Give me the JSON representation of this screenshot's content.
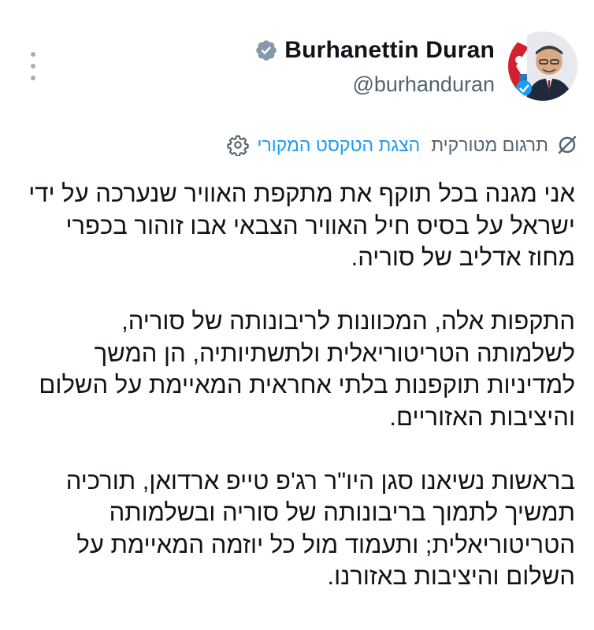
{
  "user": {
    "display_name": "Burhanettin Duran",
    "handle": "@burhanduran",
    "verified": true,
    "avatar_alt": "profile photo"
  },
  "translation": {
    "translated_from": "תרגום מטורקית",
    "show_original": "הצגת הטקסט המקורי"
  },
  "tweet": {
    "paragraphs": [
      "אני מגנה בכל תוקף את מתקפת האוויר שנערכה על ידי ישראל על בסיס חיל האוויר הצבאי אבו זוהור בכפרי מחוז אדליב של סוריה.",
      "התקפות אלה, המכוונות לריבונותה של סוריה, לשלמותה הטריטוריאלית ולתשתיותיה, הן המשך למדיניות תוקפנות בלתי אחראית המאיימת על השלום והיציבות האזוריים.",
      "בראשות נשיאנו סגן היו\"ר רג'פ טייפ ארדואן, תורכיה תמשיך לתמוך בריבונותה של סוריה ובשלמותה הטריטוריאלית; ותעמוד מול כל יוזמה המאיימת על השלום והיציבות באזורנו."
    ]
  },
  "colors": {
    "text": "#0f1419",
    "secondary": "#536471",
    "link": "#1d9bf0",
    "verified_badge": "#829aab"
  },
  "icons": {
    "more": "more-horizontal-icon",
    "verified": "verified-badge-icon",
    "translate": "translate-icon",
    "settings": "gear-icon"
  }
}
